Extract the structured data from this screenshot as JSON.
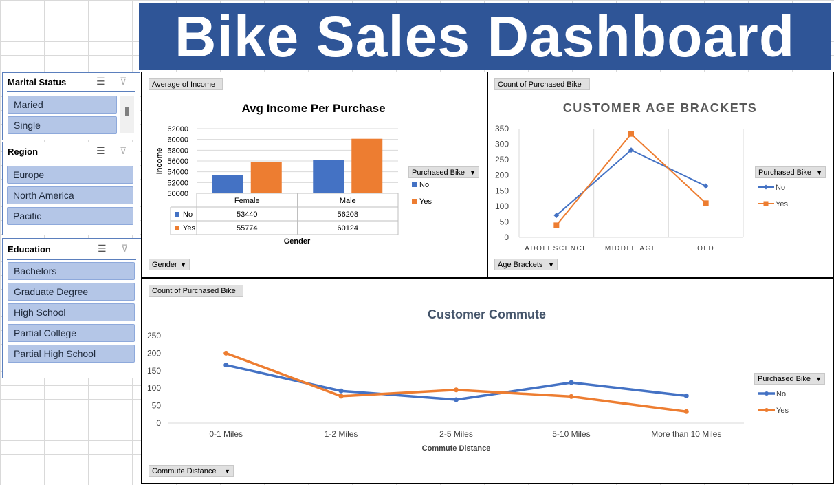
{
  "dashboard": {
    "title": "Bike Sales Dashboard"
  },
  "slicers": {
    "marital": {
      "title": "Marital Status",
      "items": [
        "Maried",
        "Single"
      ]
    },
    "region": {
      "title": "Region",
      "items": [
        "Europe",
        "North America",
        "Pacific"
      ]
    },
    "education": {
      "title": "Education",
      "items": [
        "Bachelors",
        "Graduate Degree",
        "High School",
        "Partial College",
        "Partial High School"
      ]
    }
  },
  "colors": {
    "no": "#4472c4",
    "yes": "#ed7d31",
    "banner": "#2f5597",
    "slicer_item": "#b4c6e7"
  },
  "icons": {
    "multiselect": "multi-select-icon",
    "clear_filter": "clear-filter-icon"
  },
  "income_chart": {
    "value_button": "Average of Income",
    "axis_button": "Gender",
    "legend_button": "Purchased Bike"
  },
  "age_chart": {
    "value_button": "Count of Purchased Bike",
    "axis_button": "Age Brackets",
    "legend_button": "Purchased Bike"
  },
  "commute_chart": {
    "value_button": "Count of Purchased Bike",
    "axis_button": "Commute Distance",
    "legend_button": "Purchased Bike"
  },
  "chart_data": [
    {
      "type": "bar",
      "title": "Avg Income Per Purchase",
      "xlabel": "Gender",
      "ylabel": "Income",
      "categories": [
        "Female",
        "Male"
      ],
      "series": [
        {
          "name": "No",
          "values": [
            53440,
            56208
          ]
        },
        {
          "name": "Yes",
          "values": [
            55774,
            60124
          ]
        }
      ],
      "ylim": [
        50000,
        62000
      ],
      "yticks": [
        50000,
        52000,
        54000,
        56000,
        58000,
        60000,
        62000
      ],
      "grid": true,
      "legend": "right",
      "data_table": true
    },
    {
      "type": "line",
      "title": "CUSTOMER AGE BRACKETS",
      "xlabel": "",
      "ylabel": "",
      "categories": [
        "ADOLESCENCE",
        "MIDDLE AGE",
        "OLD"
      ],
      "series": [
        {
          "name": "No",
          "values": [
            71,
            281,
            165
          ]
        },
        {
          "name": "Yes",
          "values": [
            39,
            333,
            110
          ]
        }
      ],
      "ylim": [
        0,
        350
      ],
      "yticks": [
        0,
        50,
        100,
        150,
        200,
        250,
        300,
        350
      ],
      "grid": false,
      "legend": "right"
    },
    {
      "type": "line",
      "title": "Customer Commute",
      "xlabel": "Commute Distance",
      "ylabel": "",
      "categories": [
        "0-1 Miles",
        "1-2 Miles",
        "2-5 Miles",
        "5-10 Miles",
        "More than 10 Miles"
      ],
      "series": [
        {
          "name": "No",
          "values": [
            166,
            92,
            67,
            116,
            78
          ]
        },
        {
          "name": "Yes",
          "values": [
            200,
            77,
            95,
            76,
            33
          ]
        }
      ],
      "ylim": [
        0,
        250
      ],
      "yticks": [
        0,
        50,
        100,
        150,
        200,
        250
      ],
      "grid": false,
      "legend": "right"
    }
  ]
}
